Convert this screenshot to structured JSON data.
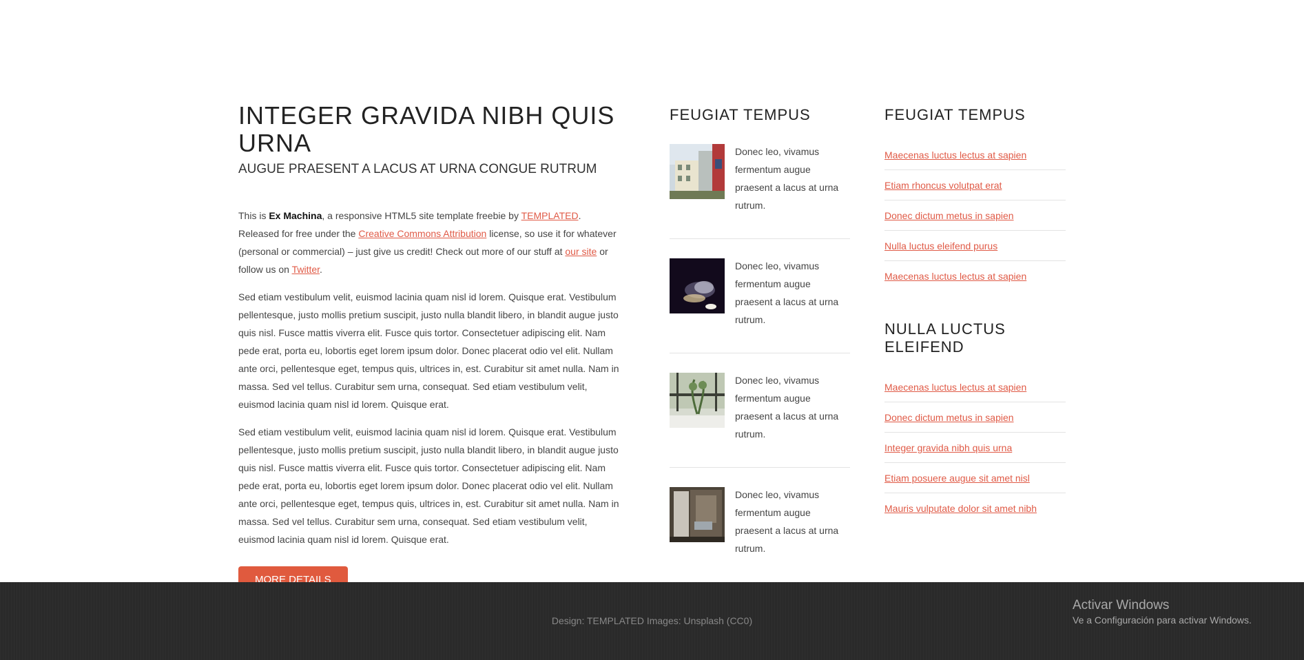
{
  "main": {
    "title": "INTEGER GRAVIDA NIBH QUIS URNA",
    "subtitle": "AUGUE PRAESENT A LACUS AT URNA CONGUE RUTRUM",
    "intro": {
      "t1": "This is ",
      "bold": "Ex Machina",
      "t2": ", a responsive HTML5 site template freebie by ",
      "link1": "TEMPLATED",
      "t3": ". Released for free under the ",
      "link2": "Creative Commons Attribution",
      "t4": " license, so use it for whatever (personal or commercial) – just give us credit! Check out more of our stuff at ",
      "link3": "our site",
      "t5": " or follow us on ",
      "link4": "Twitter",
      "t6": "."
    },
    "paragraph1": "Sed etiam vestibulum velit, euismod lacinia quam nisl id lorem. Quisque erat. Vestibulum pellentesque, justo mollis pretium suscipit, justo nulla blandit libero, in blandit augue justo quis nisl. Fusce mattis viverra elit. Fusce quis tortor. Consectetuer adipiscing elit. Nam pede erat, porta eu, lobortis eget lorem ipsum dolor. Donec placerat odio vel elit. Nullam ante orci, pellentesque eget, tempus quis, ultrices in, est. Curabitur sit amet nulla. Nam in massa. Sed vel tellus. Curabitur sem urna, consequat. Sed etiam vestibulum velit, euismod lacinia quam nisl id lorem. Quisque erat.",
    "paragraph2": "Sed etiam vestibulum velit, euismod lacinia quam nisl id lorem. Quisque erat. Vestibulum pellentesque, justo mollis pretium suscipit, justo nulla blandit libero, in blandit augue justo quis nisl. Fusce mattis viverra elit. Fusce quis tortor. Consectetuer adipiscing elit. Nam pede erat, porta eu, lobortis eget lorem ipsum dolor. Donec placerat odio vel elit. Nullam ante orci, pellentesque eget, tempus quis, ultrices in, est. Curabitur sit amet nulla. Nam in massa. Sed vel tellus. Curabitur sem urna, consequat. Sed etiam vestibulum velit, euismod lacinia quam nisl id lorem. Quisque erat.",
    "button": "MORE DETAILS"
  },
  "column2": {
    "title": "FEUGIAT TEMPUS",
    "items": [
      {
        "text": "Donec leo, vivamus fermentum augue praesent a lacus at urna rutrum."
      },
      {
        "text": "Donec leo, vivamus fermentum augue praesent a lacus at urna rutrum."
      },
      {
        "text": "Donec leo, vivamus fermentum augue praesent a lacus at urna rutrum."
      },
      {
        "text": "Donec leo, vivamus fermentum augue praesent a lacus at urna rutrum."
      }
    ]
  },
  "column3": {
    "title1": "FEUGIAT TEMPUS",
    "links1": [
      "Maecenas luctus lectus at sapien",
      "Etiam rhoncus volutpat erat",
      "Donec dictum metus in sapien",
      "Nulla luctus eleifend purus",
      "Maecenas luctus lectus at sapien"
    ],
    "title2": "NULLA LUCTUS ELEIFEND",
    "links2": [
      "Maecenas luctus lectus at sapien",
      "Donec dictum metus in sapien",
      "Integer gravida nibh quis urna",
      "Etiam posuere augue sit amet nisl",
      "Mauris vulputate dolor sit amet nibh"
    ]
  },
  "footer": {
    "credits": "Design: TEMPLATED Images: Unsplash (CC0)"
  },
  "watermark": {
    "line1": "Activar Windows",
    "line2": "Ve a Configuración para activar Windows."
  },
  "colors": {
    "accent": "#e05a46",
    "button": "#e05a3e",
    "footer_bg": "#2a2a2a"
  }
}
